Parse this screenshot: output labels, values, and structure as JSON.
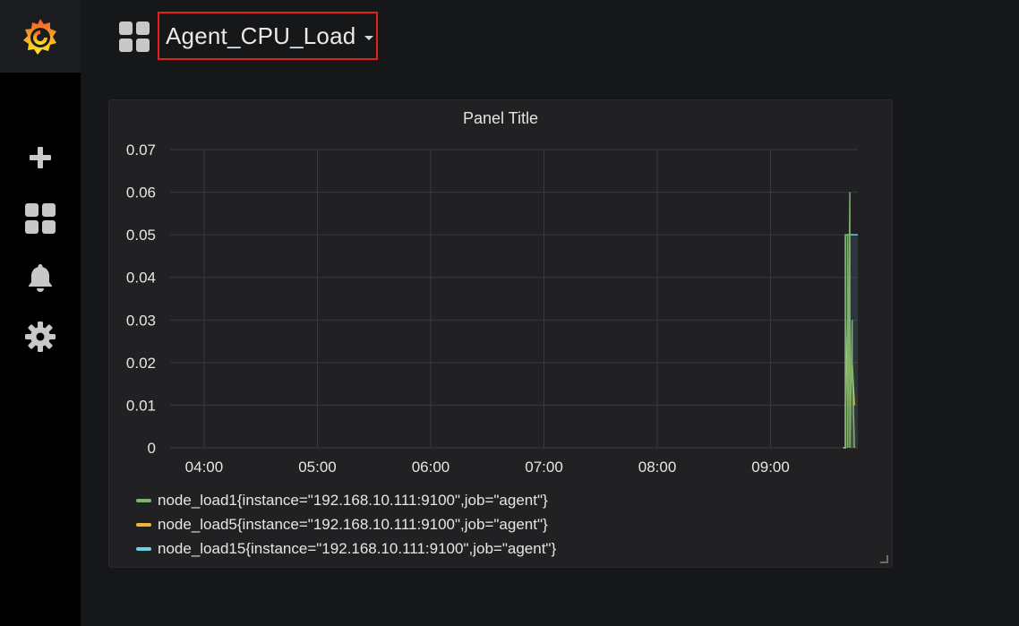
{
  "app": {
    "dashboard_title": "Agent_CPU_Load"
  },
  "sidebar": {
    "items": [
      {
        "icon": "plus-icon"
      },
      {
        "icon": "dashboards-icon"
      },
      {
        "icon": "bell-icon"
      },
      {
        "icon": "gear-icon"
      }
    ]
  },
  "colors": {
    "sidebar_bg": "#000000",
    "page_bg": "#161719",
    "panel_bg": "#212124",
    "title_border": "#e0201c",
    "series_load1": "#7eb26d",
    "series_load5": "#eab839",
    "series_load15": "#6ed0e0"
  },
  "panel": {
    "title": "Panel Title",
    "legend": [
      {
        "name": "node_load1{instance=\"192.168.10.111:9100\",job=\"agent\"}",
        "color": "#7eb26d"
      },
      {
        "name": "node_load5{instance=\"192.168.10.111:9100\",job=\"agent\"}",
        "color": "#eab839"
      },
      {
        "name": "node_load15{instance=\"192.168.10.111:9100\",job=\"agent\"}",
        "color": "#6ed0e0"
      }
    ]
  },
  "chart_data": {
    "type": "line",
    "title": "Panel Title",
    "xlabel": "",
    "ylabel": "",
    "x_ticks": [
      "04:00",
      "05:00",
      "06:00",
      "07:00",
      "08:00",
      "09:00"
    ],
    "y_ticks": [
      "0",
      "0.01",
      "0.02",
      "0.03",
      "0.04",
      "0.05",
      "0.06",
      "0.07"
    ],
    "ylim": [
      0,
      0.07
    ],
    "xlim_hours": [
      3.7,
      9.77
    ],
    "grid": true,
    "legend_position": "bottom-left",
    "series": [
      {
        "name": "node_load1{instance=\"192.168.10.111:9100\",job=\"agent\"}",
        "color": "#7eb26d",
        "x_hours": [
          9.64,
          9.66,
          9.66,
          9.68,
          9.68,
          9.7,
          9.7,
          9.72,
          9.72,
          9.74
        ],
        "values": [
          0,
          0,
          0.05,
          0.05,
          0,
          0.06,
          0,
          0.03,
          0.02,
          0
        ]
      },
      {
        "name": "node_load5{instance=\"192.168.10.111:9100\",job=\"agent\"}",
        "color": "#eab839",
        "x_hours": [
          9.64,
          9.66,
          9.66,
          9.68,
          9.68,
          9.7,
          9.7,
          9.72,
          9.72,
          9.74
        ],
        "values": [
          0,
          0,
          0.01,
          0.03,
          0.01,
          0.03,
          0.01,
          0.02,
          0.02,
          0.01
        ]
      },
      {
        "name": "node_load15{instance=\"192.168.10.111:9100\",job=\"agent\"}",
        "color": "#6ed0e0",
        "x_hours": [
          9.64,
          9.66,
          9.66,
          9.77
        ],
        "values": [
          0,
          0,
          0.05,
          0.05
        ]
      }
    ]
  }
}
